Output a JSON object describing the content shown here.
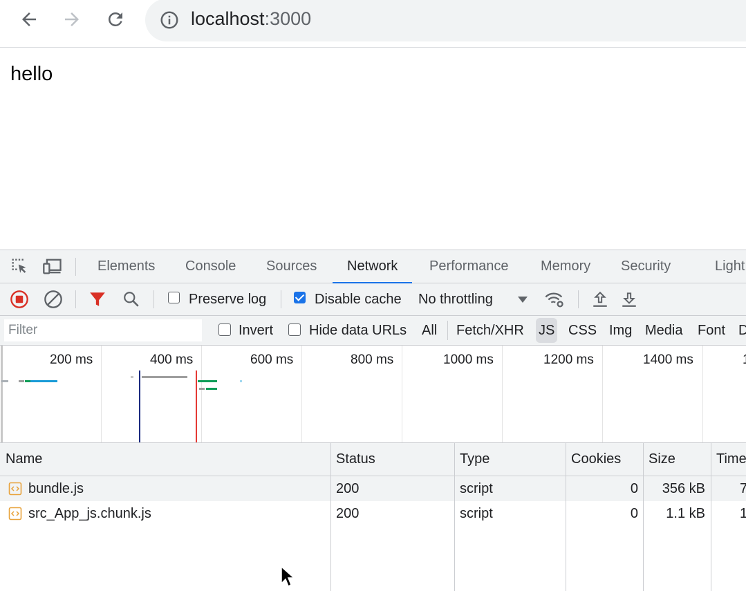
{
  "browser": {
    "url_host": "localhost",
    "url_port": ":3000"
  },
  "page": {
    "text": "hello"
  },
  "devtools": {
    "tabs": [
      "Elements",
      "Console",
      "Sources",
      "Network",
      "Performance",
      "Memory",
      "Security",
      "Light"
    ],
    "active_tab": "Network",
    "toolbar": {
      "preserve_log_label": "Preserve log",
      "preserve_log_checked": false,
      "disable_cache_label": "Disable cache",
      "disable_cache_checked": true,
      "throttling_value": "No throttling"
    },
    "filter": {
      "placeholder": "Filter",
      "invert_label": "Invert",
      "hide_data_urls_label": "Hide data URLs",
      "types": [
        "All",
        "Fetch/XHR",
        "JS",
        "CSS",
        "Img",
        "Media",
        "Font",
        "D"
      ],
      "active_type": "JS"
    },
    "overview": {
      "ticks": [
        "200 ms",
        "400 ms",
        "600 ms",
        "800 ms",
        "1000 ms",
        "1200 ms",
        "1400 ms",
        "1"
      ]
    },
    "table": {
      "columns": [
        "Name",
        "Status",
        "Type",
        "Cookies",
        "Size",
        "Time"
      ],
      "rows": [
        {
          "name": "bundle.js",
          "status": "200",
          "type": "script",
          "cookies": "0",
          "size": "356 kB",
          "time": "7"
        },
        {
          "name": "src_App_js.chunk.js",
          "status": "200",
          "type": "script",
          "cookies": "0",
          "size": "1.1 kB",
          "time": "1"
        }
      ]
    },
    "colors": {
      "accent": "#1a73e8",
      "record": "#d93025",
      "filter_funnel": "#d93025",
      "file_icon": "#e8a33d"
    }
  }
}
